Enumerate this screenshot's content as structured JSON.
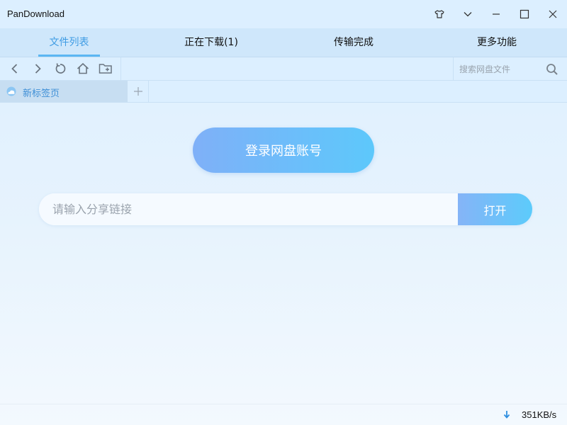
{
  "app": {
    "title": "PanDownload"
  },
  "window_controls": [
    "skin-icon",
    "dropdown-icon",
    "minimize-icon",
    "maximize-icon",
    "close-icon"
  ],
  "tabs": [
    {
      "label": "文件列表",
      "active": true
    },
    {
      "label": "正在下载(1)",
      "active": false
    },
    {
      "label": "传输完成",
      "active": false
    },
    {
      "label": "更多功能",
      "active": false
    }
  ],
  "toolbar": {
    "icons": [
      "back-icon",
      "forward-icon",
      "refresh-icon",
      "home-icon",
      "new-folder-icon"
    ],
    "search_placeholder": "搜索网盘文件"
  },
  "browser_tabs": [
    {
      "label": "新标签页",
      "icon": "cloud-icon"
    }
  ],
  "main": {
    "login_label": "登录网盘账号",
    "share_placeholder": "请输入分享链接",
    "open_label": "打开"
  },
  "status": {
    "speed": "351KB/s"
  },
  "colors": {
    "accent": "#3f9ce4",
    "button_start": "#7fb0f8",
    "button_end": "#5dc8fb"
  }
}
